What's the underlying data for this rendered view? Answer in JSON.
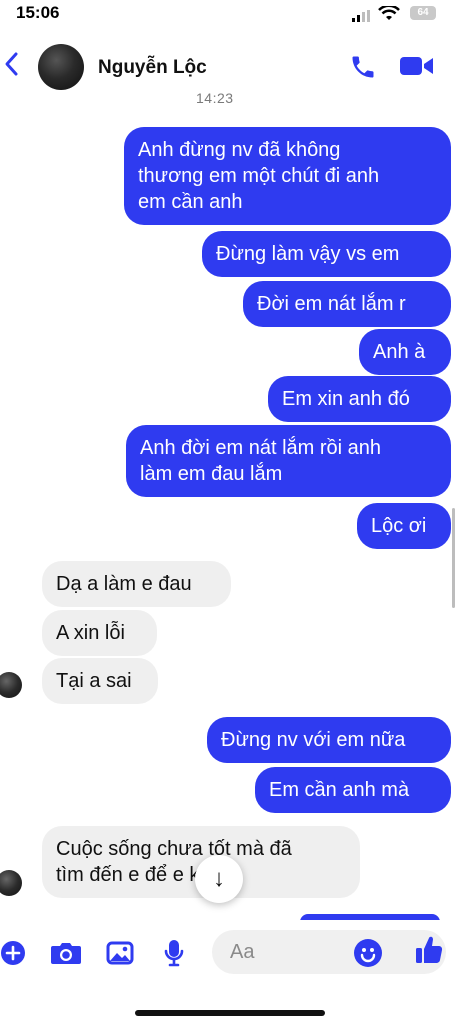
{
  "status": {
    "time": "15:06",
    "battery": "64"
  },
  "header": {
    "contact_name": "Nguyễn Lộc"
  },
  "thread": {
    "timestamp": "14:23",
    "outgoing_1": [
      "Anh đừng nv đã không",
      "thương em một chút đi anh",
      "em cần anh"
    ],
    "outgoing_2": "Đừng làm vậy vs em",
    "outgoing_3": "Đời em nát lắm r",
    "outgoing_4": "Anh à",
    "outgoing_5": "Em xin anh đó",
    "outgoing_6": [
      "Anh đời em nát lắm rồi anh",
      "làm em đau lắm"
    ],
    "outgoing_7": "Lộc ơi",
    "incoming_1": "Dạ a làm e đau",
    "incoming_2": "A xin lỗi",
    "incoming_3": "Tại a sai",
    "outgoing_8": "Đừng nv với em nữa",
    "outgoing_9": "Em cần anh mà",
    "incoming_4": [
      "Cuộc sống chưa tốt mà đã",
      "tìm đến e để e khổ"
    ]
  },
  "composer": {
    "placeholder": "Aa"
  },
  "colors": {
    "accent": "#2f3bf0",
    "incoming_bg": "#efefef"
  },
  "icons": [
    "back-chevron-icon",
    "phone-icon",
    "video-camera-icon",
    "plus-icon",
    "camera-icon",
    "image-icon",
    "microphone-icon",
    "emoji-icon",
    "thumbs-up-icon",
    "scroll-down-arrow-icon"
  ]
}
